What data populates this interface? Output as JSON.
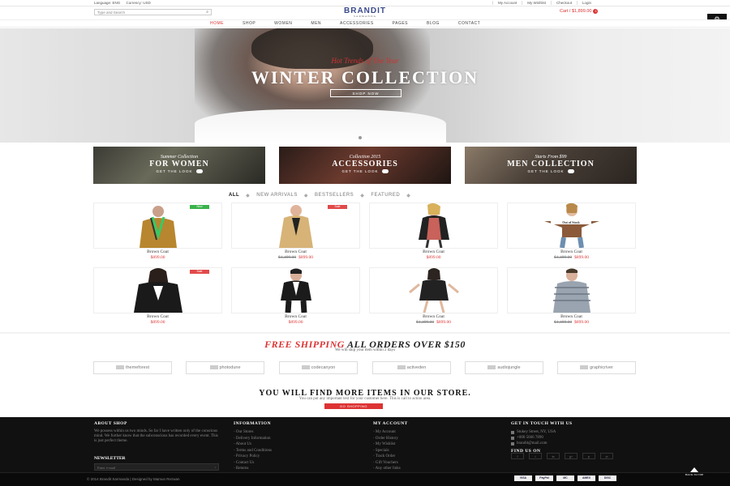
{
  "topbar": {
    "language": "Language: ENG",
    "currency": "Currency: USD",
    "links": [
      "My Account",
      "My Wishlist",
      "Checkout",
      "Login"
    ]
  },
  "header": {
    "search_placeholder": "Type and Search",
    "logo_main": "BRANDIT",
    "logo_sub": "SARMANDA",
    "cart_label": "Cart / $1,899.00",
    "cart_count": "3"
  },
  "nav": {
    "items": [
      "HOME",
      "SHOP",
      "WOMEN",
      "MEN",
      "ACCESSORIES",
      "PAGES",
      "BLOG",
      "CONTACT"
    ]
  },
  "hero": {
    "subtitle": "Hot Trends of The Year",
    "title": "WINTER COLLECTION",
    "button": "SHOP NOW"
  },
  "banners": [
    {
      "caption": "Summer Collection",
      "title": "FOR WOMEN",
      "link": "GET THE LOOK"
    },
    {
      "caption": "Collection 2015",
      "title": "ACCESSORIES",
      "link": "GET THE LOOK"
    },
    {
      "caption": "Starts From $99",
      "title": "MEN COLLECTION",
      "link": "GET THE LOOK"
    }
  ],
  "tabs": [
    "ALL",
    "NEW ARRIVALS",
    "BESTSELLERS",
    "FEATURED"
  ],
  "products": [
    {
      "name": "Brown Coat",
      "price": "$899.00",
      "old": "",
      "badge": "New",
      "badge_color": "#3bb34a"
    },
    {
      "name": "Brown Coat",
      "price": "$899.00",
      "old": "$1,499.00",
      "badge": "Sale",
      "badge_color": "#e24a4a"
    },
    {
      "name": "Brown Coat",
      "price": "$899.00",
      "old": "",
      "badge": "",
      "badge_color": ""
    },
    {
      "name": "Brown Coat",
      "price": "$899.00",
      "old": "$1,499.00",
      "badge": "Out of Stock",
      "badge_color": ""
    },
    {
      "name": "Brown Coat",
      "price": "$899.00",
      "old": "",
      "badge": "Sale",
      "badge_color": "#e24a4a"
    },
    {
      "name": "Brown Coat",
      "price": "$899.00",
      "old": "",
      "badge": "",
      "badge_color": ""
    },
    {
      "name": "Brown Coat",
      "price": "$899.00",
      "old": "$1,499.00",
      "badge": "",
      "badge_color": ""
    },
    {
      "name": "Brown Coat",
      "price": "$899.00",
      "old": "$1,499.00",
      "badge": "",
      "badge_color": ""
    }
  ],
  "shipping": {
    "red": "FREE SHIPPING",
    "dark": "ALL ORDERS OVER $150",
    "sub": "We will ship your item within 2 days"
  },
  "brands": [
    "themeforest",
    "photodune",
    "codecanyon",
    "activeden",
    "audiojungle",
    "graphicriver"
  ],
  "cta": {
    "title": "YOU WILL FIND MORE ITEMS IN OUR STORE.",
    "sub": "You can put any important text for your customer here. This is call to action area.",
    "button": "GO SHOPPING"
  },
  "footer": {
    "about_title": "ABOUT SHOP",
    "about_text": "We possess within us two minds. So far I have written only of the conscious mind. We further know that the subconscious has recorded every event. This is just perfect theme.",
    "newsletter_title": "NEWSLETTER",
    "newsletter_placeholder": "Enter e-mail",
    "info_title": "INFORMATION",
    "info_links": [
      "Our Stores",
      "Delivery Information",
      "About Us",
      "Terms and Conditions",
      "Privacy Policy",
      "Contact Us",
      "Returns"
    ],
    "account_title": "MY ACCOUNT",
    "account_links": [
      "My Account",
      "Order History",
      "My Wishlist",
      "Specials",
      "Track Order",
      "Gift Vouchers",
      "Any other links"
    ],
    "contact_title": "GET IN TOUCH WITH US",
    "contact_lines": [
      "Stukey Street, NY, USA",
      "+000 5666 7890",
      "brandit@mail.com"
    ],
    "find_us": "FIND US ON",
    "social": [
      "f",
      "t",
      "in",
      "g+",
      "p",
      "yt"
    ],
    "copyright": "© 2014 Brandit Sarmanda | Designed by Mamun Rezwan",
    "payments": [
      "VISA",
      "PayPal",
      "MC",
      "AMEX",
      "DISC"
    ],
    "to_top": "BACK TO TOP"
  },
  "colors": {
    "accent": "#dd3333",
    "footer_bg": "#111111",
    "logo": "#3a4a8c"
  }
}
